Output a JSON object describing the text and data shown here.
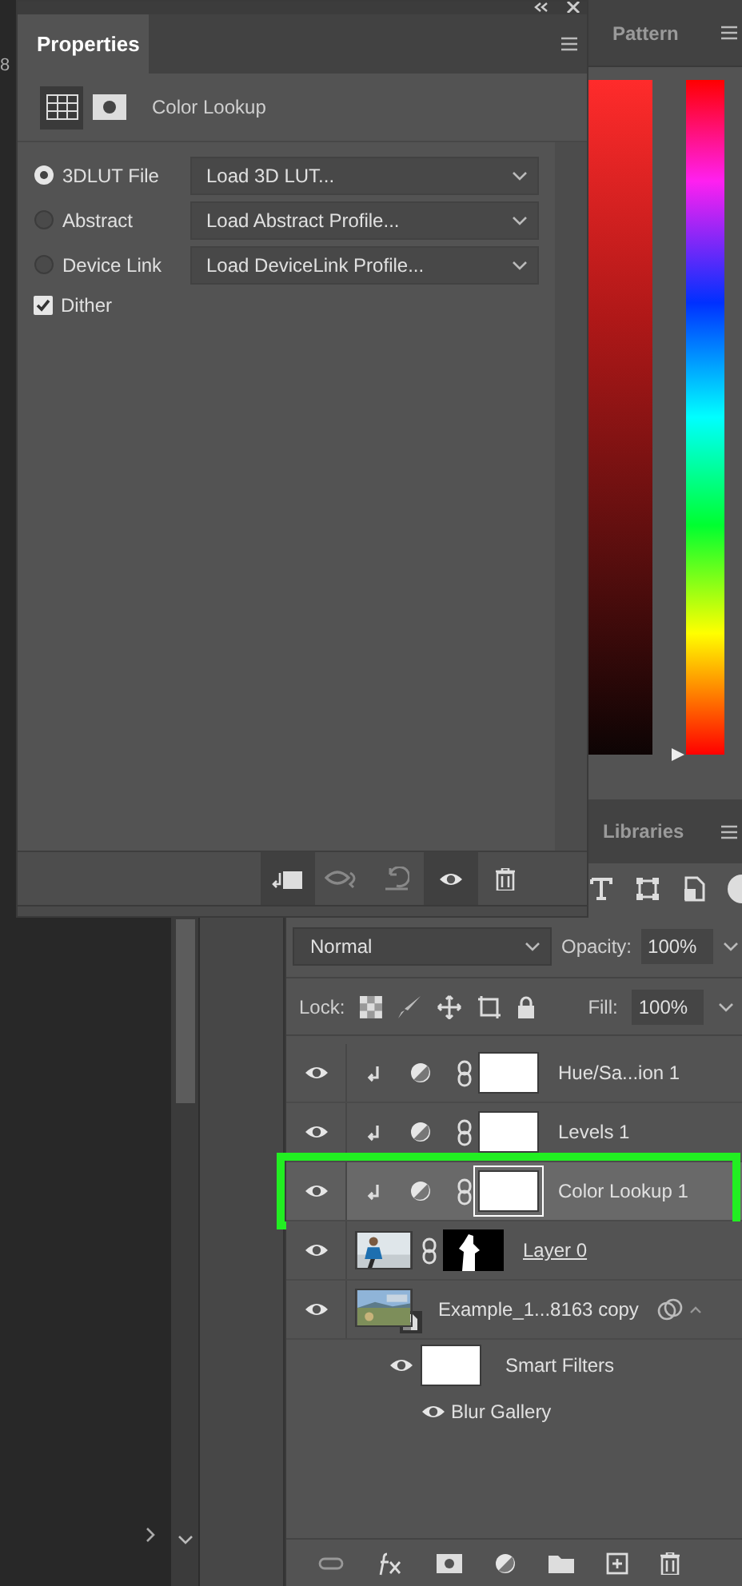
{
  "edge_text": "8",
  "properties_panel": {
    "title": "Properties",
    "adjustment": "Color Lookup",
    "options": [
      {
        "kind": "radio",
        "label": "3DLUT File",
        "selected": true,
        "dropdown": "Load 3D LUT..."
      },
      {
        "kind": "radio",
        "label": "Abstract",
        "selected": false,
        "dropdown": "Load Abstract Profile..."
      },
      {
        "kind": "radio",
        "label": "Device Link",
        "selected": false,
        "dropdown": "Load DeviceLink Profile..."
      },
      {
        "kind": "checkbox",
        "label": "Dither",
        "checked": true
      }
    ]
  },
  "patterns_panel": {
    "title": "Pattern"
  },
  "hue_slider": {
    "level": 0.0
  },
  "libraries_panel": {
    "title": "Libraries"
  },
  "layers_panel": {
    "blend_mode": "Normal",
    "opacity_label": "Opacity:",
    "opacity": "100%",
    "lock_label": "Lock:",
    "fill_label": "Fill:",
    "fill": "100%",
    "layers": [
      {
        "kind": "adjustment",
        "name": "Hue/Sa...ion 1",
        "selected": false,
        "highlighted": false
      },
      {
        "kind": "adjustment",
        "name": "Levels 1",
        "selected": false,
        "highlighted": false
      },
      {
        "kind": "adjustment",
        "name": "Color Lookup 1",
        "selected": true,
        "highlighted": true
      },
      {
        "kind": "pixel",
        "name": "Layer 0",
        "selected": false,
        "highlighted": false
      },
      {
        "kind": "smart",
        "name": "Example_1...8163 copy",
        "selected": false,
        "highlighted": false,
        "children": [
          {
            "kind": "filter_mask",
            "name": "Smart Filters"
          },
          {
            "kind": "filter",
            "name": "Blur Gallery"
          }
        ]
      }
    ]
  }
}
